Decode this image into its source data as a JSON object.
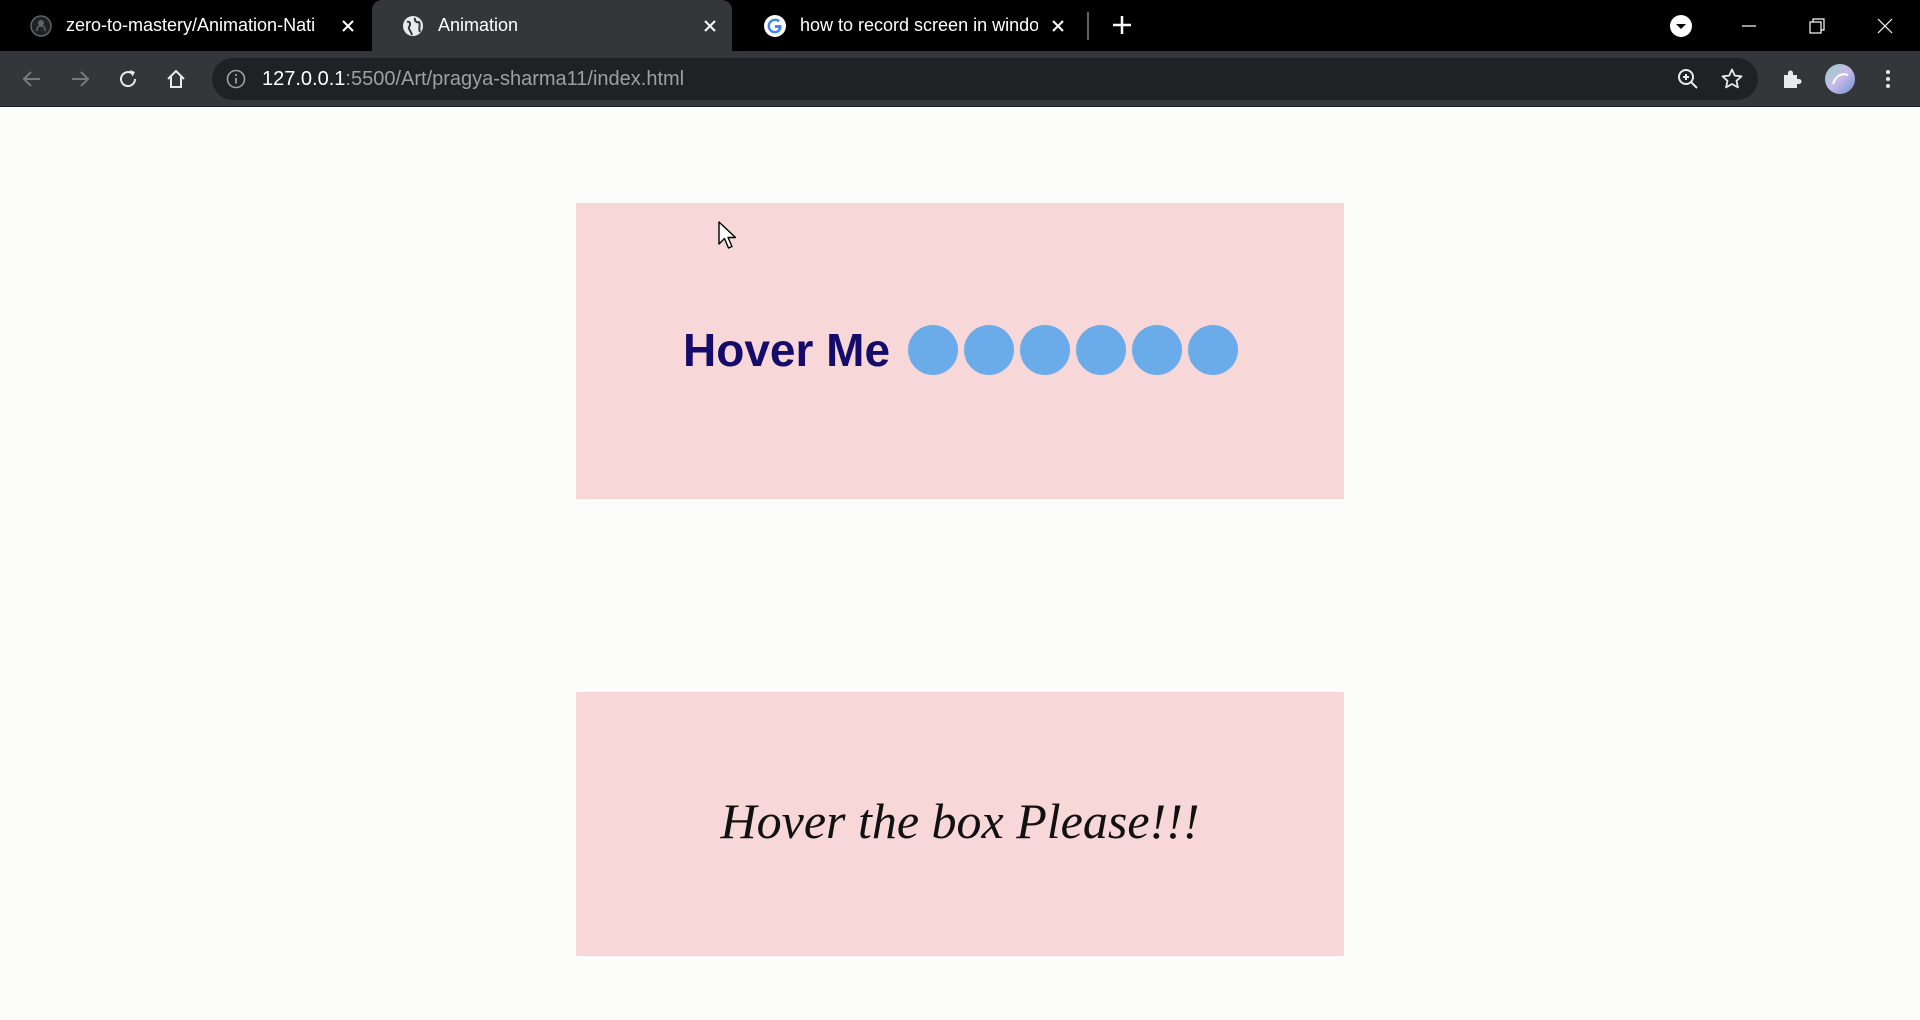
{
  "browser": {
    "tabs": [
      {
        "title": "zero-to-mastery/Animation-Nati",
        "favicon": "github-icon",
        "active": false
      },
      {
        "title": "Animation",
        "favicon": "globe-icon",
        "active": true
      },
      {
        "title": "how to record screen in windows",
        "favicon": "google-icon",
        "active": false
      }
    ],
    "address_bar": {
      "host": "127.0.0.1",
      "path": ":5500/Art/pragya-sharma11/index.html"
    }
  },
  "page": {
    "box1": {
      "label": "Hover Me",
      "dot_count": 6
    },
    "box2": {
      "label": "Hover the box Please!!!"
    }
  },
  "colors": {
    "box_background": "#f8d7d9",
    "hover_text": "#150b6b",
    "dot": "#6aabe9",
    "page_background": "#fbfbfa"
  }
}
